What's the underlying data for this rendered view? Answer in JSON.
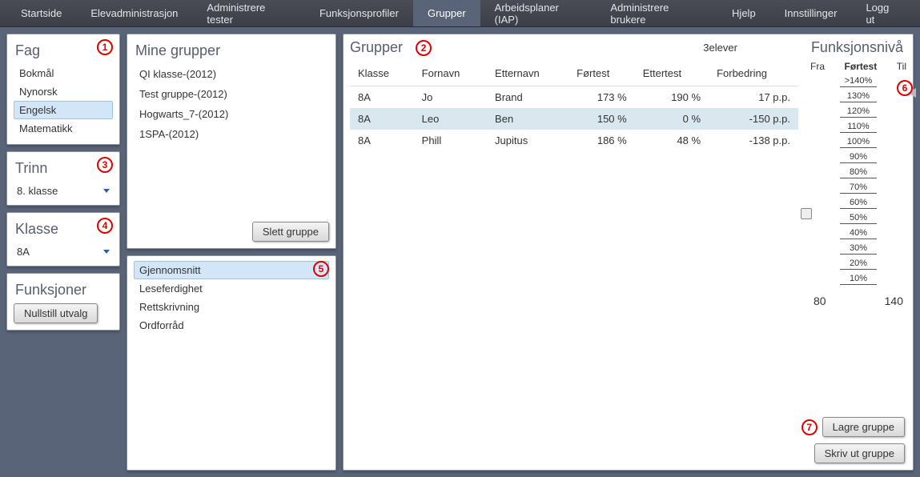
{
  "nav": {
    "items": [
      "Startside",
      "Elevadministrasjon",
      "Administrere tester",
      "Funksjonsprofiler",
      "Grupper",
      "Arbeidsplaner (IAP)",
      "Administrere brukere",
      "Hjelp",
      "Innstillinger",
      "Logg ut"
    ],
    "selected_index": 4
  },
  "fag": {
    "title": "Fag",
    "items": [
      "Bokmål",
      "Nynorsk",
      "Engelsk",
      "Matematikk"
    ],
    "selected_index": 2
  },
  "trinn": {
    "title": "Trinn",
    "value": "8. klasse"
  },
  "klasse": {
    "title": "Klasse",
    "value": "8A"
  },
  "funksjoner": {
    "title": "Funksjoner",
    "reset_btn": "Nullstill utvalg"
  },
  "mine_grupper": {
    "title": "Mine grupper",
    "items": [
      "QI klasse-(2012)",
      "Test gruppe-(2012)",
      "Hogwarts_7-(2012)",
      "1SPA-(2012)"
    ],
    "delete_btn": "Slett gruppe"
  },
  "metrics": {
    "items": [
      "Gjennomsnitt",
      "Leseferdighet",
      "Rettskrivning",
      "Ordforråd"
    ],
    "selected_index": 0
  },
  "main": {
    "title": "Grupper",
    "count_label": "3elever",
    "funk_title": "Funksjonsnivå",
    "funk_labels": {
      "fra": "Fra",
      "mid": "Førtest",
      "til": "Til"
    },
    "columns": [
      "Klasse",
      "Fornavn",
      "Etternavn",
      "Førtest",
      "Ettertest",
      "Forbedring"
    ],
    "rows": [
      {
        "klasse": "8A",
        "fornavn": "Jo",
        "etternavn": "Brand",
        "fortest": "173 %",
        "ettertest": "190 %",
        "forbedring": "17 p.p.",
        "selected": false
      },
      {
        "klasse": "8A",
        "fornavn": "Leo",
        "etternavn": "Ben",
        "fortest": "150 %",
        "ettertest": "0 %",
        "forbedring": "-150 p.p.",
        "selected": true
      },
      {
        "klasse": "8A",
        "fornavn": "Phill",
        "etternavn": "Jupitus",
        "fortest": "186 %",
        "ettertest": "48 %",
        "forbedring": "-138 p.p.",
        "selected": false
      }
    ],
    "ticks": [
      ">140%",
      "130%",
      "120%",
      "110%",
      "100%",
      "90%",
      "80%",
      "70%",
      "60%",
      "50%",
      "40%",
      "30%",
      "20%",
      "10%"
    ],
    "readout": {
      "from": "80",
      "to": "140"
    },
    "save_btn": "Lagre gruppe",
    "print_btn": "Skriv ut gruppe"
  },
  "markers": {
    "m1": "1",
    "m2": "2",
    "m3": "3",
    "m4": "4",
    "m5": "5",
    "m6": "6",
    "m7": "7"
  }
}
